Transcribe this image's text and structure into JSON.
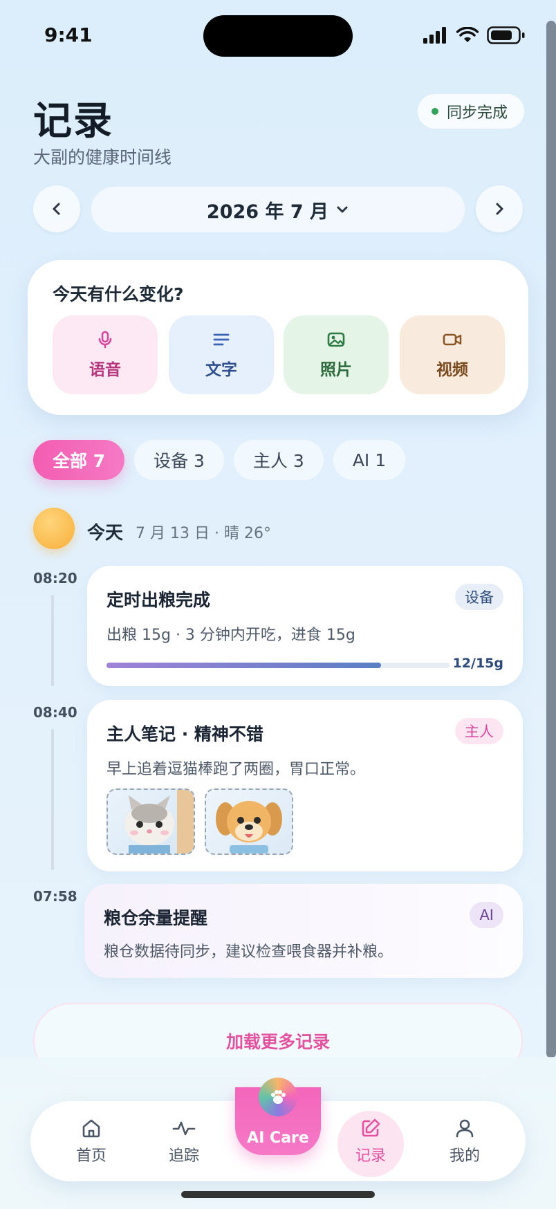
{
  "status_bar": {
    "time": "9:41"
  },
  "header": {
    "title": "记录",
    "subtitle": "大副的健康时间线",
    "sync_label": "同步完成"
  },
  "month_nav": {
    "label": "2026 年 7 月"
  },
  "quick_record": {
    "title": "今天有什么变化?",
    "buttons": [
      {
        "label": "语音",
        "icon": "microphone-icon"
      },
      {
        "label": "文字",
        "icon": "text-lines-icon"
      },
      {
        "label": "照片",
        "icon": "image-icon"
      },
      {
        "label": "视频",
        "icon": "video-camera-icon"
      }
    ]
  },
  "filters": [
    {
      "label": "全部 7",
      "active": true
    },
    {
      "label": "设备 3",
      "active": false
    },
    {
      "label": "主人 3",
      "active": false
    },
    {
      "label": "AI 1",
      "active": false
    }
  ],
  "day": {
    "label": "今天",
    "meta": "7 月 13 日 · 晴 26°"
  },
  "timeline": [
    {
      "time": "08:20",
      "title": "定时出粮完成",
      "badge": "设备",
      "desc": "出粮 15g · 3 分钟内开吃，进食 15g",
      "progress": {
        "label": "12/15g",
        "fraction": 0.8
      }
    },
    {
      "time": "08:40",
      "title": "主人笔记 · 精神不错",
      "badge": "主人",
      "desc": "早上追着逗猫棒跑了两圈，胃口正常。",
      "photos": [
        "cat-photo",
        "dog-photo"
      ]
    },
    {
      "time": "07:58",
      "title": "粮仓余量提醒",
      "badge": "AI",
      "desc": "粮仓数据待同步，建议检查喂食器并补粮。"
    }
  ],
  "load_more": "加载更多记录",
  "tabbar": {
    "items": [
      {
        "label": "首页",
        "icon": "home-icon"
      },
      {
        "label": "追踪",
        "icon": "pulse-icon"
      },
      {
        "label": "AI Care",
        "icon": "paw-orb-icon"
      },
      {
        "label": "记录",
        "icon": "edit-icon",
        "active": true
      },
      {
        "label": "我的",
        "icon": "user-icon"
      }
    ]
  },
  "colors": {
    "accent": "#f35db2",
    "device": "#2e4a7a",
    "ai": "#6a4496",
    "sync": "#33a35a"
  }
}
